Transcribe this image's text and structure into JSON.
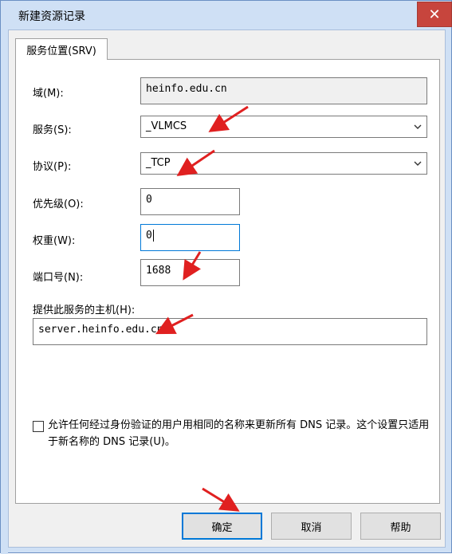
{
  "window": {
    "title": "新建资源记录",
    "close_symbol": "✕"
  },
  "tab": {
    "label": "服务位置(SRV)"
  },
  "form": {
    "domain_label": "域(M):",
    "domain_value": "heinfo.edu.cn",
    "service_label": "服务(S):",
    "service_value": "_VLMCS",
    "protocol_label": "协议(P):",
    "protocol_value": "_TCP",
    "priority_label": "优先级(O):",
    "priority_value": "0",
    "weight_label": "权重(W):",
    "weight_value": "0",
    "port_label": "端口号(N):",
    "port_value": "1688",
    "host_label": "提供此服务的主机(H):",
    "host_value": "server.heinfo.edu.cn",
    "allow_update_text": "允许任何经过身份验证的用户用相同的名称来更新所有 DNS 记录。这个设置只适用于新名称的 DNS 记录(U)。",
    "allow_update_checked": false
  },
  "buttons": {
    "ok": "确定",
    "cancel": "取消",
    "help": "帮助"
  },
  "colors": {
    "annotation_arrow": "#e02020",
    "focus_border": "#0078d7",
    "close_button": "#c7453d"
  },
  "icons": {
    "dropdown": "chevron-down-icon",
    "close": "close-icon"
  }
}
